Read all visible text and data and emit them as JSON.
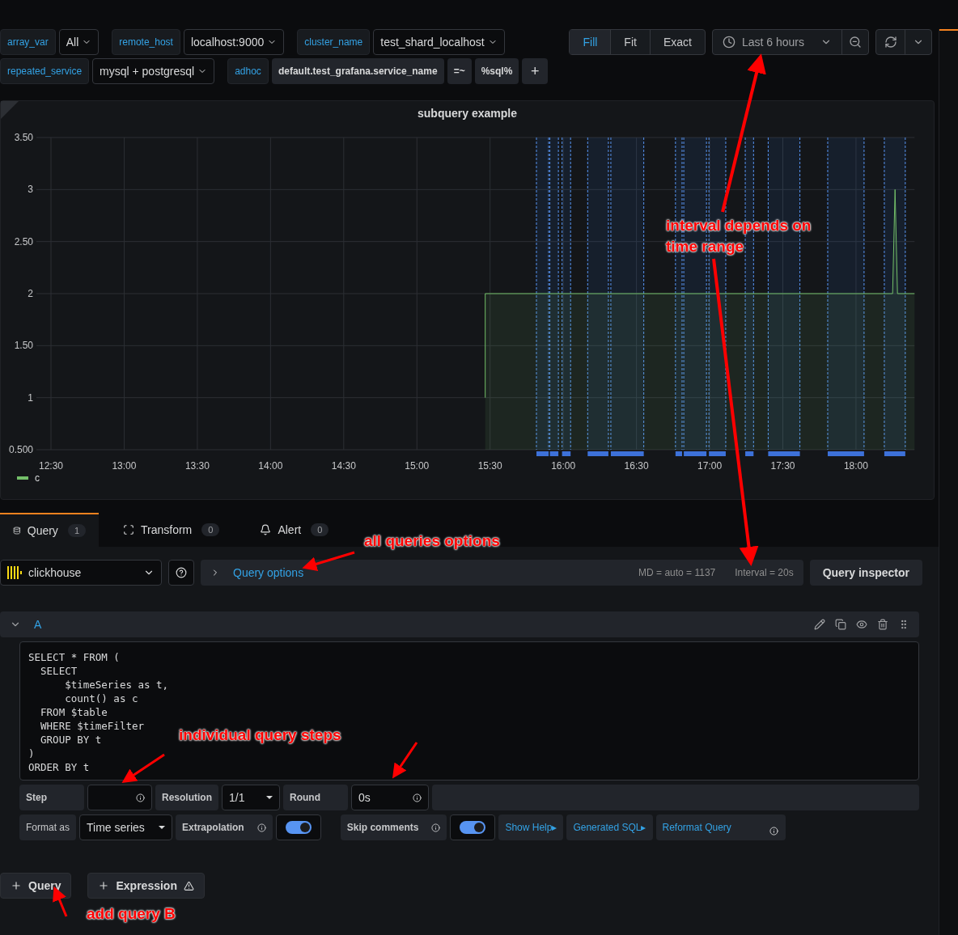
{
  "variable_rows": [
    [
      {
        "kind": "select",
        "label": "array_var",
        "value": "All"
      },
      {
        "kind": "select",
        "label": "remote_host",
        "value": "localhost:9000"
      },
      {
        "kind": "select",
        "label": "cluster_name",
        "value": "test_shard_localhost"
      }
    ],
    [
      {
        "kind": "select",
        "label": "repeated_service",
        "value": "mysql + postgresql"
      },
      {
        "kind": "adhoc",
        "label": "adhoc",
        "key": "default.test_grafana.service_name",
        "operator": "=~",
        "value": "%sql%",
        "add": "+"
      }
    ]
  ],
  "display_modes": [
    {
      "label": "Fill",
      "selected": true
    },
    {
      "label": "Fit",
      "selected": false
    },
    {
      "label": "Exact",
      "selected": false
    }
  ],
  "time_range": "Last 6 hours",
  "panel": {
    "chart_data": {
      "type": "area",
      "title": "subquery example",
      "x": [
        15.4667,
        15.4667,
        18.25,
        18.2667,
        18.2833,
        18.4
      ],
      "series": [
        {
          "name": "c",
          "color": "#73bf69",
          "values": [
            1,
            2,
            2,
            3,
            2,
            2
          ]
        }
      ],
      "xlim": [
        12.4,
        18.4
      ],
      "ylim": [
        0.5,
        3.5
      ],
      "grid": true,
      "xticks": [
        {
          "value": 12.5,
          "label": "12:30"
        },
        {
          "value": 13,
          "label": "13:00"
        },
        {
          "value": 13.5,
          "label": "13:30"
        },
        {
          "value": 14,
          "label": "14:00"
        },
        {
          "value": 14.5,
          "label": "14:30"
        },
        {
          "value": 15,
          "label": "15:00"
        },
        {
          "value": 15.5,
          "label": "15:30"
        },
        {
          "value": 16,
          "label": "16:00"
        },
        {
          "value": 16.5,
          "label": "16:30"
        },
        {
          "value": 17,
          "label": "17:00"
        },
        {
          "value": 17.5,
          "label": "17:30"
        },
        {
          "value": 18,
          "label": "18:00"
        }
      ],
      "yticks": [
        {
          "value": 3.5,
          "label": "3.50"
        },
        {
          "value": 3,
          "label": "3"
        },
        {
          "value": 2.5,
          "label": "2.50"
        },
        {
          "value": 2,
          "label": "2"
        },
        {
          "value": 1.5,
          "label": "1.50"
        },
        {
          "value": 1,
          "label": "1"
        },
        {
          "value": 0.5,
          "label": "0.500"
        }
      ]
    }
  },
  "tabs": [
    {
      "kind": "query",
      "label": "Query",
      "count": "1",
      "selected": true
    },
    {
      "kind": "transform",
      "label": "Transform",
      "count": "0",
      "selected": false
    },
    {
      "kind": "alert",
      "label": "Alert",
      "count": "0",
      "selected": false
    }
  ],
  "datasource": "clickhouse",
  "query_options": "Query options",
  "md": "MD = auto = 1137",
  "interval": "Interval = 20s",
  "inspector": "Query inspector",
  "query": {
    "ref": "A",
    "expanded": true,
    "sql": [
      "SELECT * FROM (",
      "  SELECT",
      "      $timeSeries as t,",
      "      count() as c",
      "  FROM $table",
      "  WHERE $timeFilter",
      "  GROUP BY t",
      ")",
      "ORDER BY t"
    ],
    "step_label": "Step",
    "resolution_label": "Resolution",
    "resolution": "1/1",
    "round_label": "Round",
    "round": "0s",
    "format_label": "Format as",
    "format": "Time series",
    "extrapolation_label": "Extrapolation",
    "extrapolation": true,
    "skip_comments_label": "Skip comments",
    "skip_comments": true,
    "links": [
      "Show Help▸",
      "Generated SQL▸",
      "Reformat Query"
    ]
  },
  "add_buttons": [
    {
      "kind": "query",
      "label": "Query"
    },
    {
      "kind": "expression",
      "label": "Expression"
    }
  ],
  "callouts": [
    "interval depends on time range",
    "all queries options",
    "individual query steps",
    "add query B"
  ]
}
